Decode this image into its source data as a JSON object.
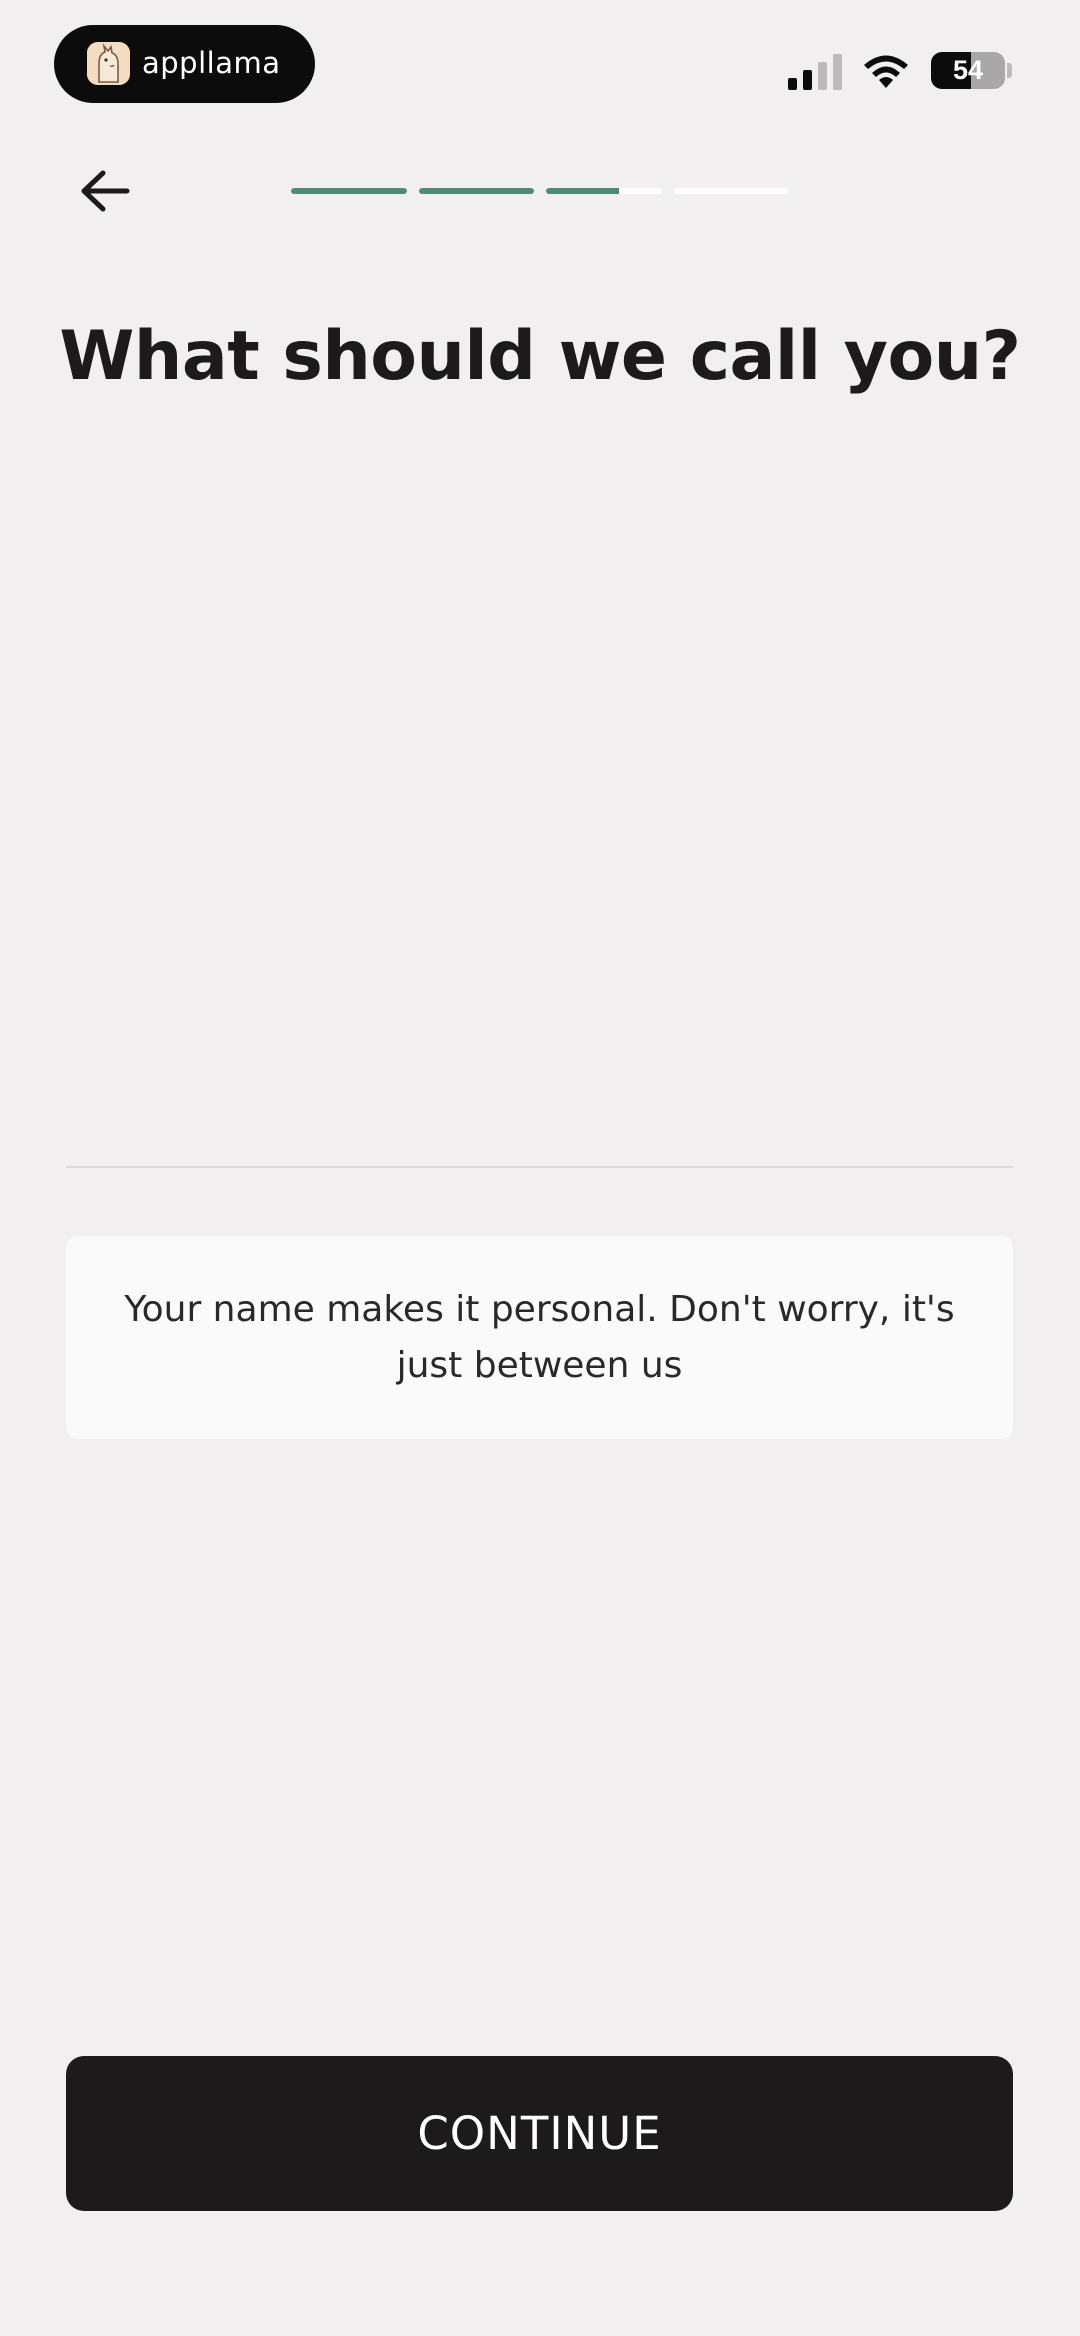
{
  "status_bar": {
    "app_pill_label": "appllama",
    "battery_level": "54",
    "battery_fraction": 0.54
  },
  "nav": {
    "back_icon": "arrow-left-icon",
    "progress": [
      1.0,
      1.0,
      0.63,
      0.0
    ],
    "progress_color": "#4e8a79"
  },
  "main": {
    "title": "What should we call you?",
    "name_input": {
      "value": "",
      "placeholder": ""
    },
    "info_text": "Your name makes it personal. Don't worry, it's just between us"
  },
  "footer": {
    "continue_label": "CONTINUE"
  },
  "colors": {
    "background": "#f1eff0",
    "button": "#1c1a1b",
    "card": "#fbfafa"
  }
}
